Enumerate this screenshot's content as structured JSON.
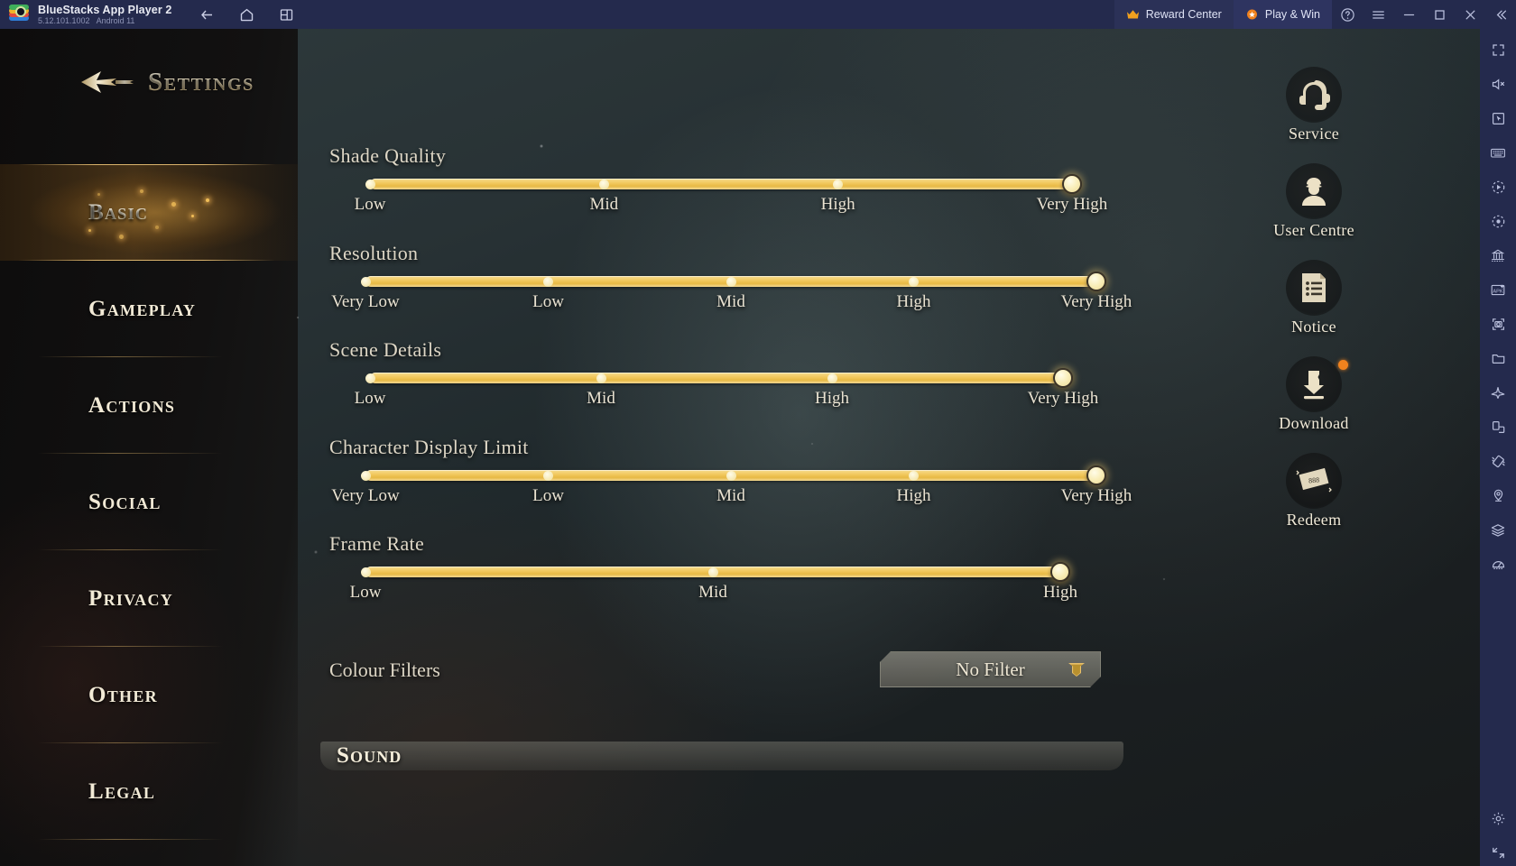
{
  "titlebar": {
    "app_name": "BlueStacks App Player 2",
    "version": "5.12.101.1002",
    "android": "Android 11",
    "nav": [
      {
        "name": "back",
        "icon": "arrow-left-icon"
      },
      {
        "name": "home",
        "icon": "home-icon"
      },
      {
        "name": "multi-instance",
        "icon": "windows-icon"
      }
    ],
    "reward_center": "Reward Center",
    "play_and_win": "Play & Win",
    "help": "help-icon",
    "menu": "hamburger-menu-icon",
    "minimize": "minimize-icon",
    "maximize": "maximize-icon",
    "close": "close-icon",
    "collapse": "collapse-icon"
  },
  "bs_toolbar": {
    "items": [
      {
        "icon": "fullscreen-icon"
      },
      {
        "icon": "mute-icon"
      },
      {
        "icon": "cursor-icon"
      },
      {
        "icon": "keyboard-icon"
      },
      {
        "icon": "macro-play-icon"
      },
      {
        "icon": "record-icon"
      },
      {
        "icon": "multi-instance-manager-icon"
      },
      {
        "icon": "install-apk-icon"
      },
      {
        "icon": "screenshot-icon"
      },
      {
        "icon": "media-folder-icon"
      },
      {
        "icon": "eco-mode-icon"
      },
      {
        "icon": "rotate-icon"
      },
      {
        "icon": "shake-icon"
      },
      {
        "icon": "location-icon"
      },
      {
        "icon": "layers-icon"
      },
      {
        "icon": "performance-icon"
      }
    ],
    "bottom": [
      {
        "icon": "settings-gear-icon"
      },
      {
        "icon": "expand-arrows-icon"
      }
    ]
  },
  "settings": {
    "title": "Settings",
    "back_icon": "back-arrow-icon",
    "nav_items": [
      {
        "label": "Basic",
        "active": true
      },
      {
        "label": "Gameplay",
        "active": false
      },
      {
        "label": "Actions",
        "active": false
      },
      {
        "label": "Social",
        "active": false
      },
      {
        "label": "Privacy",
        "active": false
      },
      {
        "label": "Other",
        "active": false
      },
      {
        "label": "Legal",
        "active": false
      }
    ],
    "sliders": [
      {
        "name": "Shade Quality",
        "options": [
          "Low",
          "Mid",
          "High",
          "Very High"
        ],
        "value_index": 3,
        "value": "Very High"
      },
      {
        "name": "Resolution",
        "options": [
          "Very Low",
          "Low",
          "Mid",
          "High",
          "Very High"
        ],
        "value_index": 4,
        "value": "Very High"
      },
      {
        "name": "Scene Details",
        "options": [
          "Low",
          "Mid",
          "High",
          "Very High"
        ],
        "value_index": 3,
        "value": "Very High"
      },
      {
        "name": "Character Display Limit",
        "options": [
          "Very Low",
          "Low",
          "Mid",
          "High",
          "Very High"
        ],
        "value_index": 4,
        "value": "Very High"
      },
      {
        "name": "Frame Rate",
        "options": [
          "Low",
          "Mid",
          "High"
        ],
        "value_index": 2,
        "value": "High"
      }
    ],
    "colour_filters": {
      "label": "Colour Filters",
      "value": "No Filter",
      "chevron": "chevron-down-icon"
    },
    "sound_section": "Sound"
  },
  "game_icons": [
    {
      "label": "Service",
      "icon": "headset-icon",
      "badge": false
    },
    {
      "label": "User Centre",
      "icon": "avatar-icon",
      "badge": false
    },
    {
      "label": "Notice",
      "icon": "notice-icon",
      "badge": false
    },
    {
      "label": "Download",
      "icon": "download-icon",
      "badge": true
    },
    {
      "label": "Redeem",
      "icon": "ticket-icon",
      "badge": false
    }
  ],
  "colors": {
    "titlebar_bg": "#242a4d",
    "accent_gold": "#f2c95f",
    "badge_orange": "#f0821e",
    "text_cream": "#efe8d6"
  }
}
